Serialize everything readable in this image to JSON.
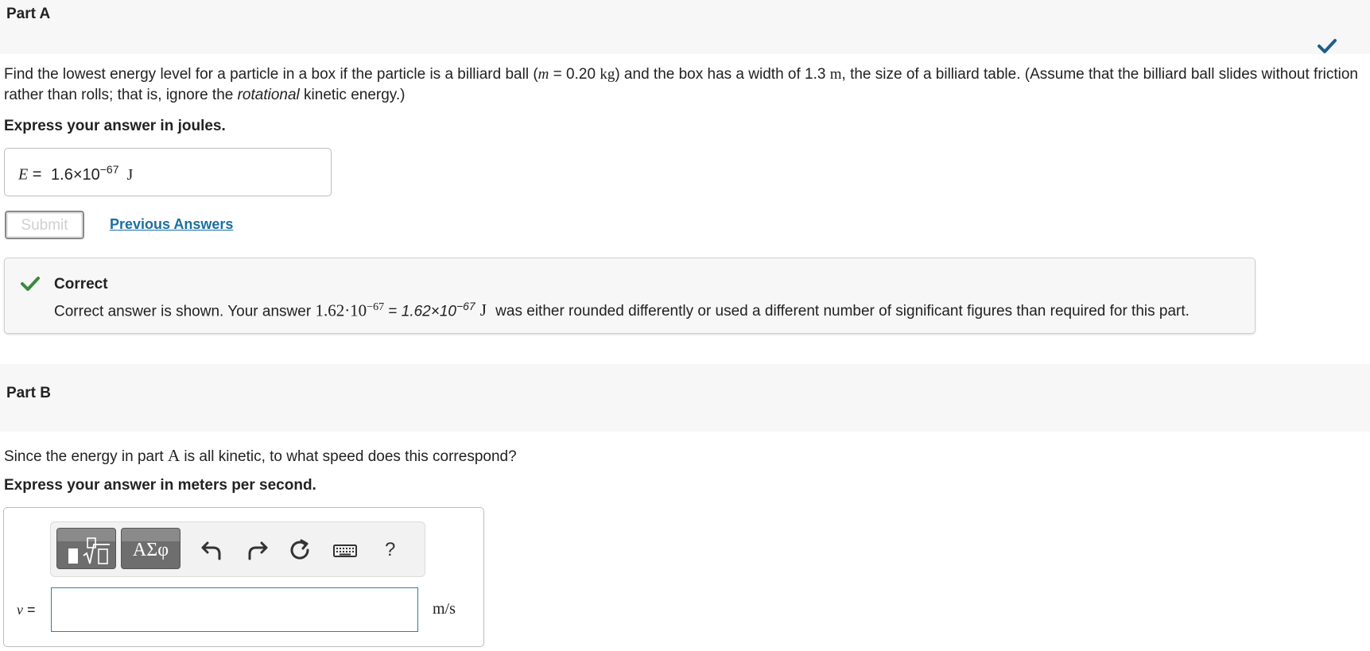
{
  "partA": {
    "title": "Part A",
    "status": "correct",
    "question": {
      "t1": "Find the lowest energy level for a particle in a box if the particle is a billiard ball (",
      "mass_var": "m",
      "t2": " = 0.20 ",
      "mass_unit": "kg",
      "t3": ") and the box has a width of 1.3 ",
      "width_unit": "m",
      "t4": ", the size of a billiard table. (Assume that the billiard ball slides without friction rather than rolls; that is, ignore the ",
      "emph": "rotational",
      "t5": " kinetic energy.)"
    },
    "instruction": "Express your answer in joules.",
    "answer": {
      "variable": "E",
      "equals": " = ",
      "mantissa": "1.6×10",
      "exponent": "−67",
      "unit": "J"
    },
    "submit_label": "Submit",
    "previous_answers_label": "Previous Answers",
    "feedback": {
      "title": "Correct",
      "t1": "Correct answer is shown. Your answer ",
      "your_mantissa": "1.62·10",
      "your_exponent": "−67",
      "t2": " = ",
      "correct_mantissa": "1.62×10",
      "correct_exponent": "−67",
      "unit": "J",
      "t3": " was either rounded differently or used a different number of significant figures than required for this part."
    }
  },
  "partB": {
    "title": "Part B",
    "question": {
      "t1": "Since the energy in part ",
      "ref": "A",
      "t2": " is all kinetic, to what speed does this correspond?"
    },
    "instruction": "Express your answer in meters per second.",
    "toolbar": {
      "symbols_label": "ΑΣφ",
      "help_label": "?"
    },
    "input": {
      "variable": "v",
      "equals": " =",
      "value": "",
      "units": "m/s"
    }
  },
  "colors": {
    "accent_check_partA": "#1d5f8a",
    "feedback_check": "#3b8a3e",
    "link": "#1a6fa0",
    "input_border": "#2a7fa8"
  },
  "icons": {
    "part_status": "checkmark-icon",
    "feedback": "checkmark-icon",
    "toolbar": [
      "templates-icon",
      "symbols-icon",
      "undo-icon",
      "redo-icon",
      "reset-icon",
      "keyboard-icon",
      "help-icon"
    ]
  }
}
